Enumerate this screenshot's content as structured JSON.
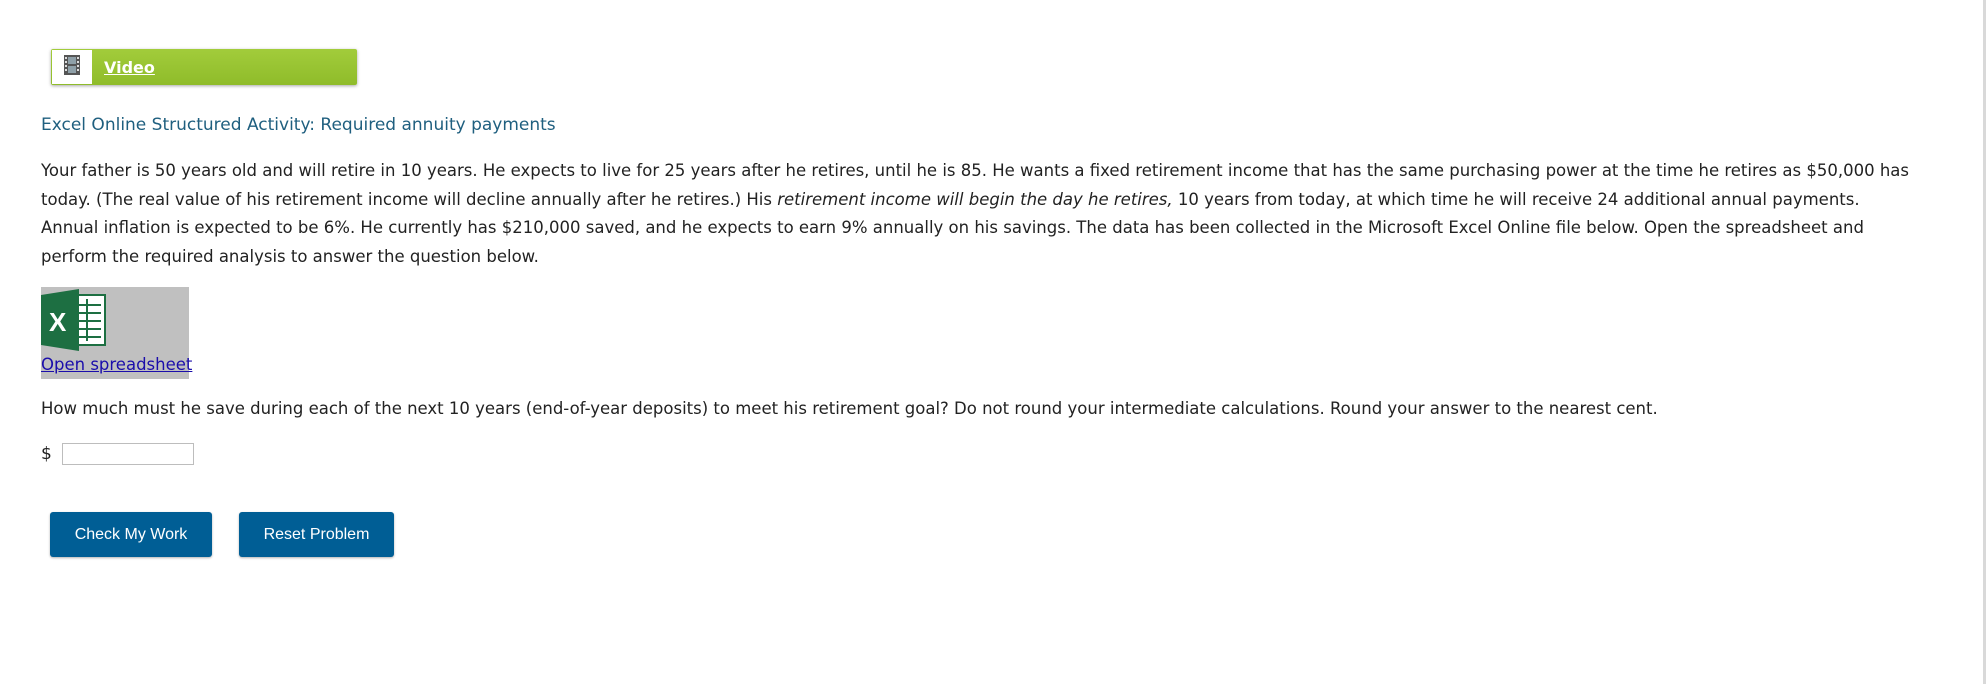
{
  "video": {
    "icon": "film-icon",
    "label": "Video",
    "color": "#99c435"
  },
  "activity": {
    "title": "Excel Online Structured Activity: Required annuity payments",
    "title_color": "#1f5f7f"
  },
  "problem": {
    "part1": "Your father is 50 years old and will retire in 10 years. He expects to live for 25 years after he retires, until he is 85. He wants a fixed retirement income that has the same purchasing power at the time he retires as $50,000 has today. (The real value of his retirement income will decline annually after he retires.) His ",
    "emphasis": "retirement income will begin the day he retires,",
    "part2": " 10 years from today, at which time he will receive 24 additional annual payments. Annual inflation is expected to be 6%. He currently has $210,000 saved, and he expects to earn 9% annually on his savings. The data has been collected in the Microsoft Excel Online file below. Open the spreadsheet and perform the required analysis to answer the question below."
  },
  "spreadsheet": {
    "icon": "excel-icon",
    "link_label": "Open spreadsheet"
  },
  "question": {
    "text": "How much must he save during each of the next 10 years (end-of-year deposits) to meet his retirement goal? Do not round your intermediate calculations. Round your answer to the nearest cent."
  },
  "answer": {
    "currency": "$",
    "value": "",
    "placeholder": ""
  },
  "buttons": {
    "check_label": "Check My Work",
    "reset_label": "Reset Problem",
    "color": "#005e95"
  }
}
